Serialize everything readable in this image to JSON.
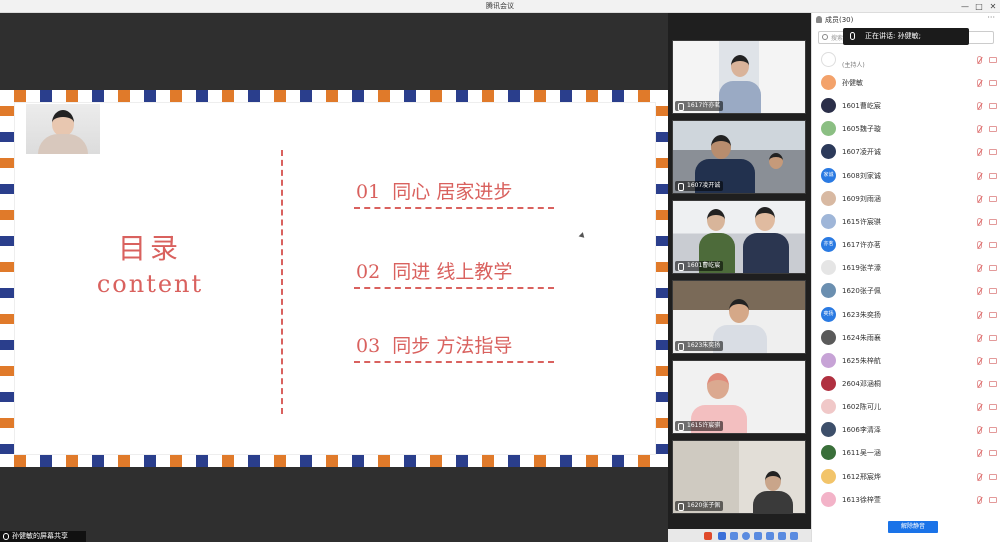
{
  "window": {
    "title": "腾讯会议",
    "controls": [
      "—",
      "□",
      "✕"
    ]
  },
  "slide": {
    "heading_cn": "目录",
    "heading_en": "content",
    "items": [
      {
        "num": "01",
        "text": "同心  居家进步"
      },
      {
        "num": "02",
        "text": "同进  线上教学"
      },
      {
        "num": "03",
        "text": "同步  方法指导"
      }
    ]
  },
  "share_bar": {
    "label": "孙健敏的屏幕共享"
  },
  "video_tiles": [
    {
      "name": "1617许亦茗"
    },
    {
      "name": "1607凌开诚"
    },
    {
      "name": "1601曹屹宸"
    },
    {
      "name": "1623朱奕扬"
    },
    {
      "name": "1615许宸骐"
    },
    {
      "name": "1620张子佩"
    }
  ],
  "members": {
    "title": "成员(30)",
    "more": "···",
    "search_placeholder": "搜索",
    "speaking_toast": "正在讲话: 孙健敏;",
    "host": {
      "name": "",
      "role": "(主持人)"
    },
    "rows": [
      {
        "name": "孙健敏",
        "avatar": "",
        "color": "#f3a26b"
      },
      {
        "name": "1601曹屹宸",
        "avatar": "",
        "color": "#2b2f49"
      },
      {
        "name": "1605魏子璇",
        "avatar": "",
        "color": "#8bbf83"
      },
      {
        "name": "1607凌开诚",
        "avatar": "",
        "color": "#2c3a5a"
      },
      {
        "name": "1608刘家诚",
        "avatar": "家诚",
        "color": "#2a7ae2"
      },
      {
        "name": "1609刘雨涵",
        "avatar": "",
        "color": "#d8b9a2"
      },
      {
        "name": "1615许宸骐",
        "avatar": "",
        "color": "#9fb6d8"
      },
      {
        "name": "1617许亦茗",
        "avatar": "亦茗",
        "color": "#2a7ae2"
      },
      {
        "name": "1619张芊濠",
        "avatar": "",
        "color": "#e5e5e5"
      },
      {
        "name": "1620张子佩",
        "avatar": "",
        "color": "#6b8fb0"
      },
      {
        "name": "1623朱奕扬",
        "avatar": "奕扬",
        "color": "#2a7ae2"
      },
      {
        "name": "1624朱雨襄",
        "avatar": "",
        "color": "#5a5a5a"
      },
      {
        "name": "1625朱梓航",
        "avatar": "",
        "color": "#c7a3d6"
      },
      {
        "name": "2604邓涵桐",
        "avatar": "",
        "color": "#b03040"
      },
      {
        "name": "1602陈可儿",
        "avatar": "",
        "color": "#f0c8c8"
      },
      {
        "name": "1606李清泽",
        "avatar": "",
        "color": "#3d4f6a"
      },
      {
        "name": "1611吴一涵",
        "avatar": "",
        "color": "#3a6f3a"
      },
      {
        "name": "1612邢宸烨",
        "avatar": "",
        "color": "#f2c46a"
      },
      {
        "name": "1613徐梓萱",
        "avatar": "",
        "color": "#f3b3c8"
      }
    ]
  },
  "unmute_button": {
    "label": "解除静音"
  },
  "colors": {
    "accent": "#d9615e",
    "stripe_orange": "#e07a2a",
    "stripe_blue": "#2a3e8c",
    "button_blue": "#1a73e8"
  }
}
